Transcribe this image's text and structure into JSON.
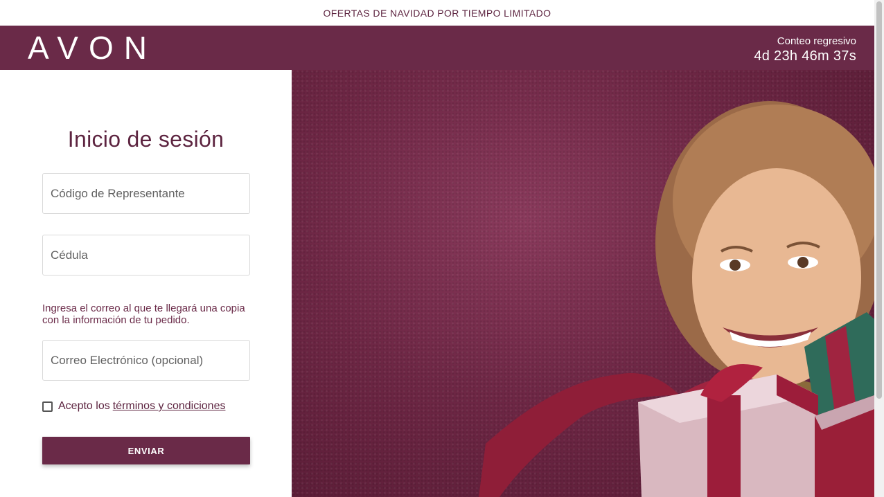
{
  "promo": {
    "text": "OFERTAS DE NAVIDAD POR TIEMPO LIMITADO"
  },
  "header": {
    "logo": "AVON",
    "countdown_label": "Conteo regresivo",
    "countdown_value": "4d 23h 46m 37s"
  },
  "login": {
    "title": "Inicio de sesión",
    "code_placeholder": "Código de Representante",
    "id_placeholder": "Cédula",
    "email_hint": "Ingresa el correo al que te llegará una copia con la información de tu pedido.",
    "email_placeholder": "Correo Electrónico (opcional)",
    "terms_prefix": "Acepto los",
    "terms_link": "términos y condiciones",
    "terms_checked": false,
    "submit_label": "ENVIAR"
  },
  "colors": {
    "brand": "#6a2a48",
    "text_accent": "#5d2440"
  }
}
